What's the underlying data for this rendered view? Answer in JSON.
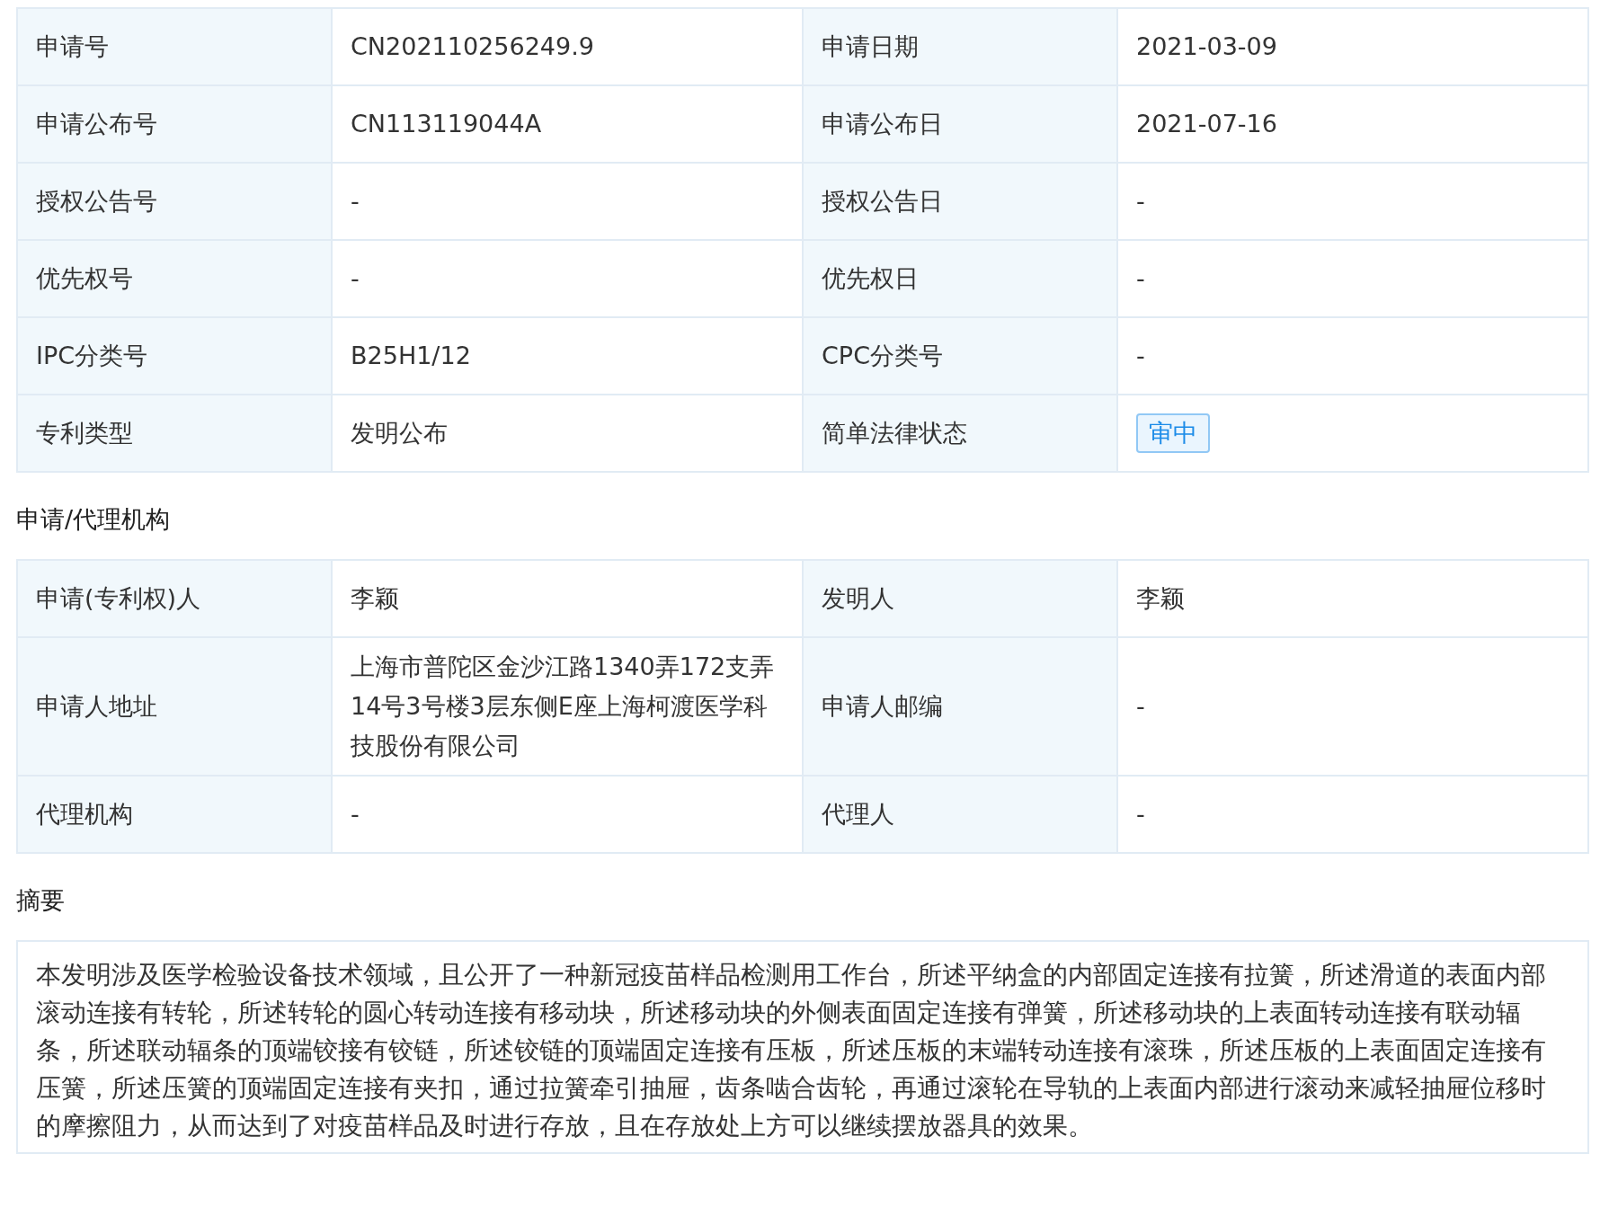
{
  "basic_info": {
    "rows": [
      {
        "label": "申请号",
        "value": "CN202110256249.9",
        "label_2": "申请日期",
        "value_2": "2021-03-09"
      },
      {
        "label": "申请公布号",
        "value": "CN113119044A",
        "label_2": "申请公布日",
        "value_2": "2021-07-16"
      },
      {
        "label": "授权公告号",
        "value": "-",
        "label_2": "授权公告日",
        "value_2": "-"
      },
      {
        "label": "优先权号",
        "value": "-",
        "label_2": "优先权日",
        "value_2": "-"
      },
      {
        "label": "IPC分类号",
        "value": "B25H1/12",
        "label_2": "CPC分类号",
        "value_2": "-"
      },
      {
        "label": "专利类型",
        "value": "发明公布",
        "label_2": "简单法律状态",
        "value_2": {
          "kind": "tag",
          "text": "审中"
        }
      }
    ]
  },
  "agency": {
    "title": "申请/代理机构",
    "rows": [
      {
        "label": "申请(专利权)人",
        "value": "李颖",
        "label_2": "发明人",
        "value_2": "李颖"
      },
      {
        "label": "申请人地址",
        "value": "上海市普陀区金沙江路1340弄172支弄14号3号楼3层东侧E座上海柯渡医学科技股份有限公司",
        "label_2": "申请人邮编",
        "value_2": "-"
      },
      {
        "label": "代理机构",
        "value": "-",
        "label_2": "代理人",
        "value_2": "-"
      }
    ]
  },
  "abstract": {
    "title": "摘要",
    "text": "本发明涉及医学检验设备技术领域，且公开了一种新冠疫苗样品检测用工作台，所述平纳盒的内部固定连接有拉簧，所述滑道的表面内部滚动连接有转轮，所述转轮的圆心转动连接有移动块，所述移动块的外侧表面固定连接有弹簧，所述移动块的上表面转动连接有联动辐条，所述联动辐条的顶端铰接有铰链，所述铰链的顶端固定连接有压板，所述压板的末端转动连接有滚珠，所述压板的上表面固定连接有压簧，所述压簧的顶端固定连接有夹扣，通过拉簧牵引抽屉，齿条啮合齿轮，再通过滚轮在导轨的上表面内部进行滚动来减轻抽屉位移时的摩擦阻力，从而达到了对疫苗样品及时进行存放，且在存放处上方可以继续摆放器具的效果。"
  }
}
